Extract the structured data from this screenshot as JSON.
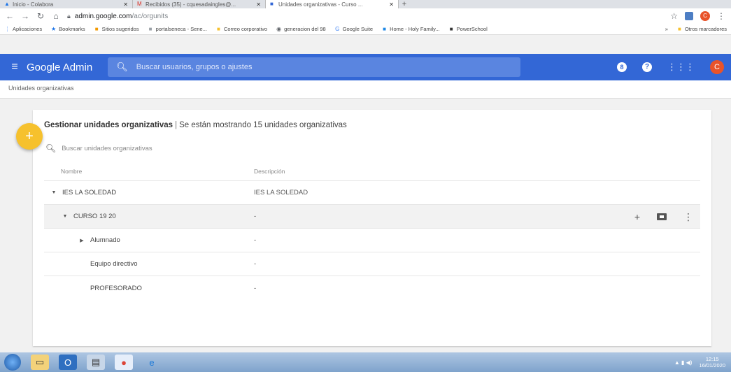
{
  "browser": {
    "tabs": [
      {
        "title": "Inicio - Colabora",
        "favicon": "colabora-icon",
        "active": false
      },
      {
        "title": "Recibidos (35) - cquesadaingles@...",
        "favicon": "gmail-icon",
        "active": false
      },
      {
        "title": "Unidades organizativas - Curso ...",
        "favicon": "admin-icon",
        "active": true
      }
    ],
    "url_host": "admin.google.com",
    "url_path": "/ac/orgunits",
    "profile_initial": "C",
    "bookmarks": [
      {
        "label": "Aplicaciones",
        "icon": "apps-grid-icon",
        "color": "#4285f4"
      },
      {
        "label": "Bookmarks",
        "icon": "star-icon",
        "color": "#1a73e8"
      },
      {
        "label": "Sitios sugeridos",
        "icon": "suggested-icon",
        "color": "#f29900"
      },
      {
        "label": "portalseneca - Sene...",
        "icon": "page-icon",
        "color": "#9aa0a6"
      },
      {
        "label": "Correo corporativo",
        "icon": "folder-icon",
        "color": "#f6c12d"
      },
      {
        "label": "generacion del 98",
        "icon": "web-icon",
        "color": "#5f6368"
      },
      {
        "label": "Google Suite",
        "icon": "google-icon",
        "color": "#4285f4"
      },
      {
        "label": "Home - Holy Family...",
        "icon": "page-icon",
        "color": "#1e88e5"
      },
      {
        "label": "PowerSchool",
        "icon": "page-icon",
        "color": "#333333"
      }
    ],
    "bookmarks_more": "»",
    "other_bookmarks": "Otros marcadores"
  },
  "admin": {
    "brand": "Google Admin",
    "search_placeholder": "Buscar usuarios, grupos o ajustes",
    "notification_badge": "8",
    "help_glyph": "?",
    "avatar_initial": "C"
  },
  "breadcrumb": "Unidades organizativas",
  "card": {
    "title_bold": "Gestionar unidades organizativas",
    "title_sep": "|",
    "title_rest": "Se están mostrando 15 unidades organizativas",
    "search_placeholder": "Buscar unidades organizativas",
    "col_name": "Nombre",
    "col_desc": "Descripción",
    "rows": [
      {
        "name": "IES LA SOLEDAD",
        "desc": "IES LA SOLEDAD",
        "caret": "▼",
        "level": 0
      },
      {
        "name": "CURSO 19 20",
        "desc": "-",
        "caret": "▼",
        "level": 1
      },
      {
        "name": "Alumnado",
        "desc": "-",
        "caret": "▶",
        "level": 2
      },
      {
        "name": "Equipo directivo",
        "desc": "-",
        "caret": "",
        "level": 2
      },
      {
        "name": "PROFESORADO",
        "desc": "-",
        "caret": "",
        "level": 2
      }
    ]
  },
  "taskbar": {
    "time": "12:15",
    "date": "16/01/2020"
  },
  "colors": {
    "header": "#3367d6",
    "fab": "#f6c12d",
    "avatar": "#e8532a"
  }
}
